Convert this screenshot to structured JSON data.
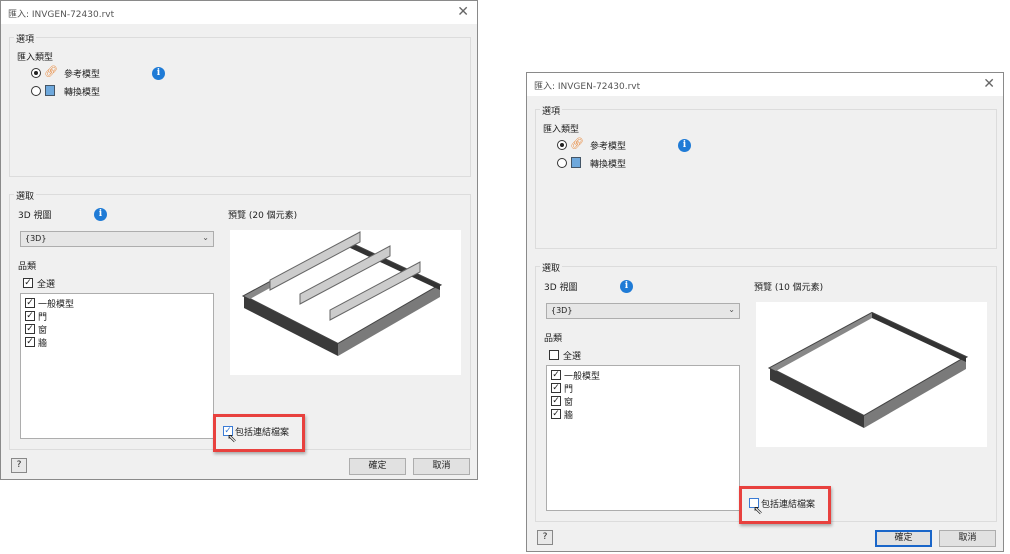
{
  "dialogs": [
    {
      "title": "匯入: INVGEN-72430.rvt",
      "options_label": "選項",
      "import_type_label": "匯入類型",
      "radio_reference": "參考模型",
      "radio_convert": "轉換模型",
      "selection_label": "選取",
      "view_label": "3D 視圖",
      "view_value": "{3D}",
      "category_label": "品類",
      "select_all": "全選",
      "select_all_checked": true,
      "categories": [
        {
          "label": "一般模型",
          "checked": true
        },
        {
          "label": "門",
          "checked": true
        },
        {
          "label": "窗",
          "checked": true
        },
        {
          "label": "牆",
          "checked": true
        }
      ],
      "preview_label": "預覽 (20 個元素)",
      "include_linked": "包括連結檔案",
      "include_linked_checked": true,
      "ok": "確定",
      "cancel": "取消",
      "help": "?"
    },
    {
      "title": "匯入: INVGEN-72430.rvt",
      "options_label": "選項",
      "import_type_label": "匯入類型",
      "radio_reference": "參考模型",
      "radio_convert": "轉換模型",
      "selection_label": "選取",
      "view_label": "3D 視圖",
      "view_value": "{3D}",
      "category_label": "品類",
      "select_all": "全選",
      "select_all_checked": false,
      "categories": [
        {
          "label": "一般模型",
          "checked": true
        },
        {
          "label": "門",
          "checked": true
        },
        {
          "label": "窗",
          "checked": true
        },
        {
          "label": "牆",
          "checked": true
        }
      ],
      "preview_label": "預覽 (10 個元素)",
      "include_linked": "包括連結檔案",
      "include_linked_checked": false,
      "ok": "確定",
      "cancel": "取消",
      "help": "?"
    }
  ]
}
